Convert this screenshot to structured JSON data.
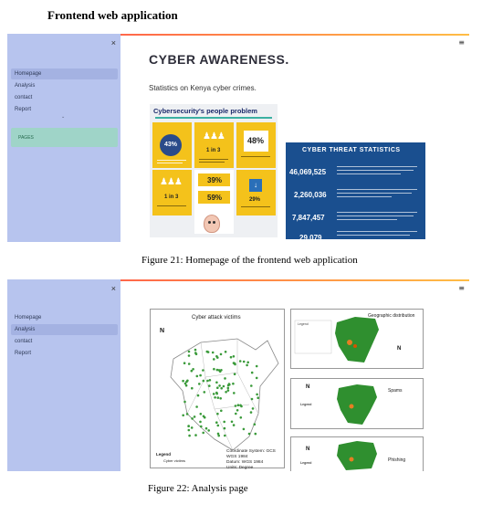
{
  "document": {
    "heading": "Frontend web application",
    "figure21_caption": "Figure 21: Homepage of the frontend web application",
    "figure22_caption": "Figure 22: Analysis page"
  },
  "app": {
    "close_glyph": "×",
    "menu_glyph": "≡",
    "collapse_glyph": "⌄",
    "nav_items": [
      "Homepage",
      "Analysis",
      "contact",
      "Report"
    ],
    "pages_label": "PAGES"
  },
  "homepage": {
    "title": "CYBER AWARENESS.",
    "subtitle": "Statistics on Kenya cyber crimes.",
    "infographic": {
      "title": "Cybersecurity's people problem",
      "tiles": [
        {
          "label": "Use the same",
          "value": "43%"
        },
        {
          "label": "Cloudy on the details",
          "value": "1 in 3"
        },
        {
          "label": "Who uses password",
          "value": "48%"
        },
        {
          "label": "Focusing on passwords",
          "value": "1 in 3"
        },
        {
          "label": "Reused passwords",
          "value": "39%"
        },
        {
          "label": "Pages",
          "value": "59%"
        },
        {
          "label": "Mobile device",
          "value": "29%"
        }
      ]
    },
    "stats": {
      "title": "CYBER THREAT STATISTICS",
      "items": [
        {
          "value": "46,069,525",
          "desc": "The number of malware threat events detected during the period October - December 2020."
        },
        {
          "value": "2,260,036",
          "desc": "The number of DDoS/Botnet threat events detected during the period October - December 2020."
        },
        {
          "value": "7,847,457",
          "desc": "The number of Web Application attack threat events detected during the period October - December 2020."
        },
        {
          "value": "29,079",
          "desc": "The number of System Vulnerabilities threat events detected during the period October - December 2020."
        }
      ]
    }
  },
  "analysis": {
    "main_map_title": "Cyber attack victims",
    "north_label": "N",
    "legend_title": "Legend",
    "legend_item": "Cyber victims",
    "coordinate_system": "Coordinate System: GCS WGS 1984",
    "datum": "Datum: WGS 1984",
    "units": "Units: Degree",
    "panels": [
      {
        "title": "Geographic distribution"
      },
      {
        "title": "Spams"
      },
      {
        "title": "Phishing"
      }
    ],
    "colors": {
      "map_green": "#2f8f2f",
      "dot_green": "#3a9a3a",
      "hotspot": "#e67e22"
    }
  }
}
